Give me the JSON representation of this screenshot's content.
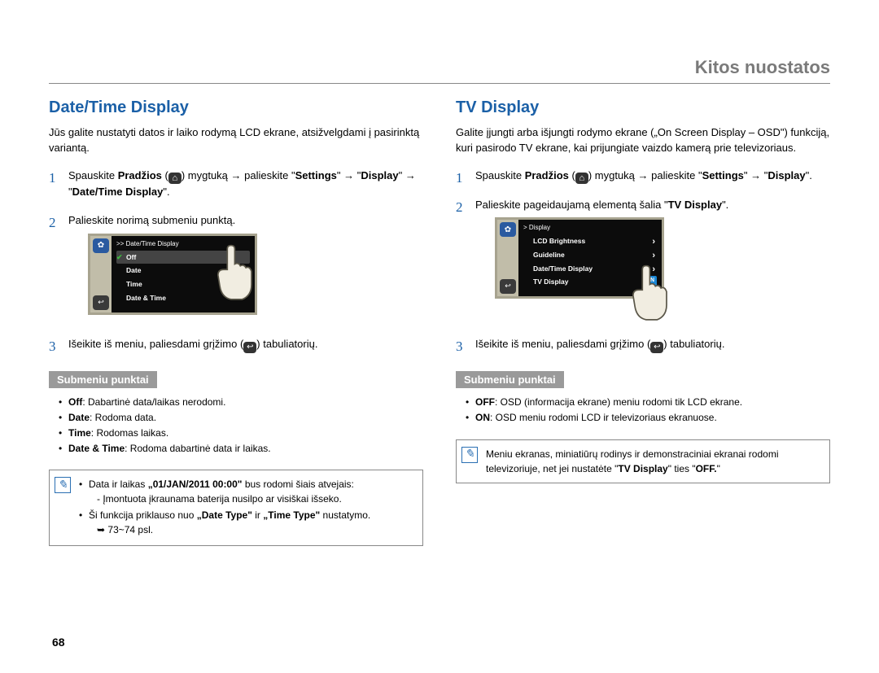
{
  "chapter": "Kitos nuostatos",
  "page_number": "68",
  "left": {
    "title": "Date/Time Display",
    "intro": "Jūs galite nustatyti datos ir laiko rodymą LCD ekrane, atsižvelgdami į pasirinktą variantą.",
    "step1_a": "Spauskite ",
    "step1_b": "Pradžios",
    "step1_c": " (",
    "step1_d": ") mygtuką ",
    "step1_arrow": "→",
    "step1_e": " palieskite \"",
    "step1_f": "Settings",
    "step1_g": "\" ",
    "step1_h": " \"",
    "step1_i": "Display",
    "step1_j": "\" ",
    "step1_k": " \"",
    "step1_l": "Date/Time Display",
    "step1_m": "\".",
    "step2": "Palieskite norimą submeniu punktą.",
    "step3_a": "Išeikite iš meniu, paliesdami grįžimo (",
    "step3_b": ") tabuliatorių.",
    "device": {
      "header": ">> Date/Time Display",
      "rows": [
        "Off",
        "Date",
        "Time",
        "Date & Time"
      ]
    },
    "sub_heading": "Submeniu punktai",
    "sub_items": [
      {
        "term": "Off",
        "desc": ": Dabartinė data/laikas nerodomi."
      },
      {
        "term": "Date",
        "desc": ": Rodoma data."
      },
      {
        "term": "Time",
        "desc": ": Rodomas laikas."
      },
      {
        "term": "Date & Time",
        "desc": ": Rodoma dabartinė data ir laikas."
      }
    ],
    "note": {
      "line1_a": "Data ir laikas ",
      "line1_b": "„01/JAN/2011 00:00\"",
      "line1_c": " bus rodomi šiais atvejais:",
      "sub1": "- Įmontuota įkraunama baterija nusilpo ar visiškai išseko.",
      "line2_a": "Ši funkcija priklauso nuo ",
      "line2_b": "„Date Type\"",
      "line2_c": " ir ",
      "line2_d": "„Time Type\"",
      "line2_e": " nustatymo.",
      "pageref": "➥ 73~74 psl."
    }
  },
  "right": {
    "title": "TV Display",
    "intro": "Galite įjungti arba išjungti rodymo ekrane („On Screen Display – OSD\") funkciją, kuri pasirodo TV ekrane, kai prijungiate vaizdo kamerą prie televizoriaus.",
    "step1_a": "Spauskite ",
    "step1_b": "Pradžios",
    "step1_c": " (",
    "step1_d": ") mygtuką ",
    "step1_arrow": "→",
    "step1_e": " palieskite \"",
    "step1_f": "Settings",
    "step1_g": "\" ",
    "step1_h": " \"",
    "step1_i": "Display",
    "step1_j": "\".",
    "step2_a": "Palieskite pageidaujamą elementą šalia \"",
    "step2_b": "TV Display",
    "step2_c": "\".",
    "step3_a": "Išeikite iš meniu, paliesdami grįžimo (",
    "step3_b": ") tabuliatorių.",
    "device": {
      "header": "> Display",
      "rows": [
        "LCD Brightness",
        "Guideline",
        "Date/Time Display",
        "TV Display"
      ],
      "on": "ON"
    },
    "sub_heading": "Submeniu punktai",
    "sub_items": [
      {
        "term": "OFF",
        "desc": ": OSD (informacija ekrane) meniu rodomi tik LCD ekrane."
      },
      {
        "term": "ON",
        "desc": ": OSD meniu rodomi LCD ir televizoriaus ekranuose."
      }
    ],
    "note": {
      "text_a": "Meniu ekranas, miniatiūrų rodinys ir demonstraciniai ekranai rodomi televizoriuje, net jei nustatėte \"",
      "text_b": "TV Display",
      "text_c": "\" ties \"",
      "text_d": "OFF.",
      "text_e": "\""
    }
  }
}
